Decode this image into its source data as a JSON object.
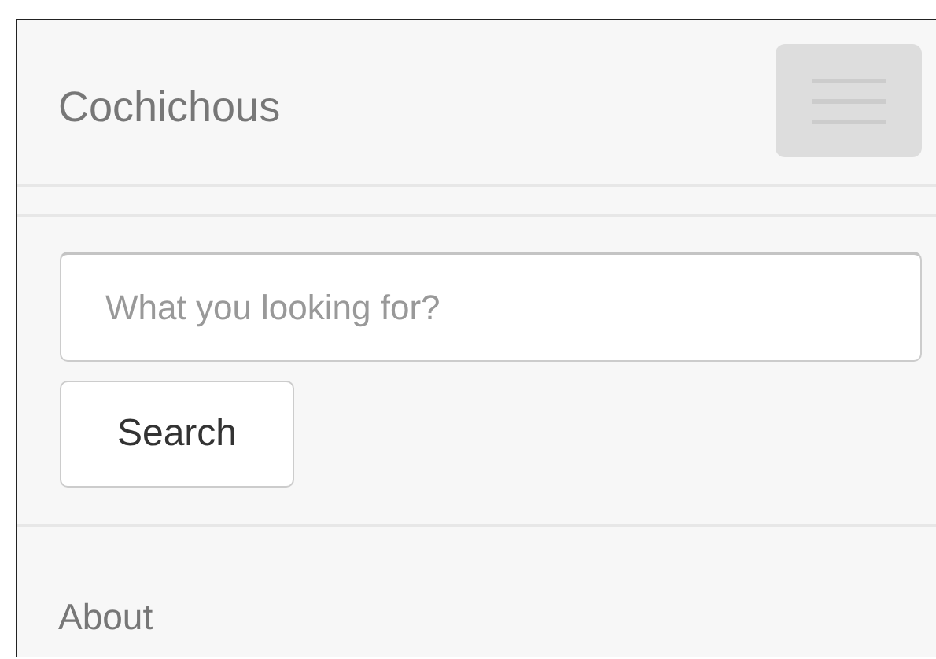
{
  "navbar": {
    "brand": "Cochichous",
    "toggle": {
      "expanded": true
    }
  },
  "search": {
    "placeholder": "What you looking for?",
    "button": "Search"
  },
  "nav_items": [
    {
      "label": "About"
    }
  ]
}
